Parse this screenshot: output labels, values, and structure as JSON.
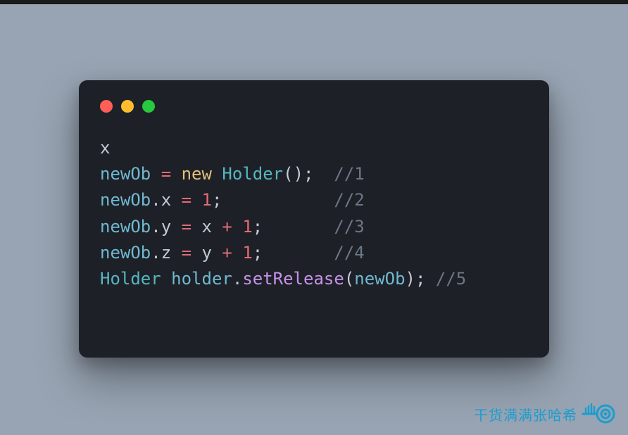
{
  "window": {
    "traffic": {
      "colors": [
        "#ff5f56",
        "#ffbd2e",
        "#27c93f"
      ]
    }
  },
  "code": {
    "line1": {
      "text": "x"
    },
    "line2": {
      "ident": "newOb",
      "assign": "=",
      "kw": "new",
      "type": "Holder",
      "parens": "();",
      "pad": "  ",
      "comment": "//1"
    },
    "line3": {
      "ident": "newOb",
      "dot": ".",
      "prop": "x",
      "assign": "=",
      "num": "1",
      "semi": ";",
      "pad": "           ",
      "comment": "//2"
    },
    "line4": {
      "ident": "newOb",
      "dot": ".",
      "prop": "y",
      "assign": "=",
      "var": "x",
      "plus": "+",
      "num": "1",
      "semi": ";",
      "pad": "       ",
      "comment": "//3"
    },
    "line5": {
      "ident": "newOb",
      "dot": ".",
      "prop": "z",
      "assign": "=",
      "var": "y",
      "plus": "+",
      "num": "1",
      "semi": ";",
      "pad": "       ",
      "comment": "//4"
    },
    "line6": {
      "type": "Holder",
      "sp": " ",
      "ident": "holder",
      "dot": ".",
      "func": "setRelease",
      "open": "(",
      "arg": "newOb",
      "close": ");",
      "pad": " ",
      "comment": "//5"
    }
  },
  "watermark": {
    "text": "干货满满张哈希"
  }
}
